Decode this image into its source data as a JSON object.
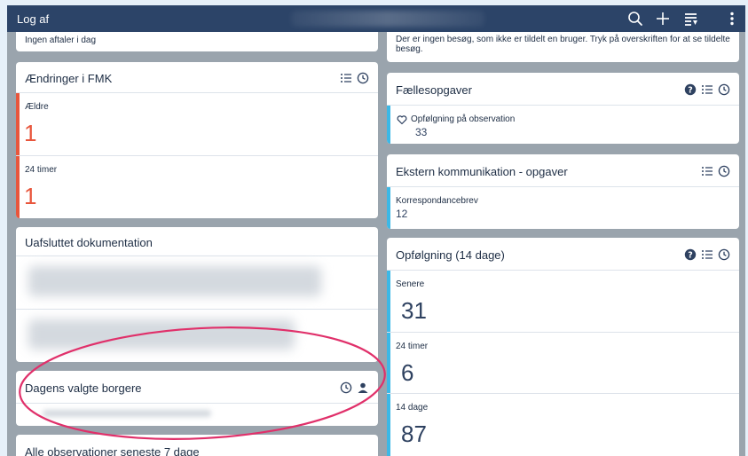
{
  "topbar": {
    "logout_label": "Log af"
  },
  "left": {
    "top_partial_text": "Ingen aftaler i dag",
    "fmk": {
      "title": "Ændringer i FMK",
      "rows": [
        {
          "label": "Ældre",
          "value": "1"
        },
        {
          "label": "24 timer",
          "value": "1"
        }
      ]
    },
    "uafsluttet": {
      "title": "Uafsluttet dokumentation"
    },
    "dagens": {
      "title": "Dagens valgte borgere"
    },
    "alle": {
      "title": "Alle observationer seneste 7 dage"
    }
  },
  "right": {
    "top_partial_text": "Der er ingen besøg, som ikke er tildelt en bruger. Tryk på overskriften for at se tildelte besøg.",
    "faelles": {
      "title": "Fællesopgaver",
      "item_label": "Opfølgning på observation",
      "item_value": "33"
    },
    "ekstern": {
      "title": "Ekstern kommunikation - opgaver",
      "item_label": "Korrespondancebrev",
      "item_value": "12"
    },
    "opfolgning": {
      "title": "Opfølgning (14 dage)",
      "rows": [
        {
          "label": "Senere",
          "value": "31"
        },
        {
          "label": "24 timer",
          "value": "6"
        },
        {
          "label": "14 dage",
          "value": "87"
        }
      ]
    }
  },
  "colors": {
    "topbar": "#2c4468",
    "alert_red": "#e8563c",
    "accent_blue": "#3cb8e6",
    "number_dark": "#2e4160",
    "annotation": "#e0306a"
  }
}
